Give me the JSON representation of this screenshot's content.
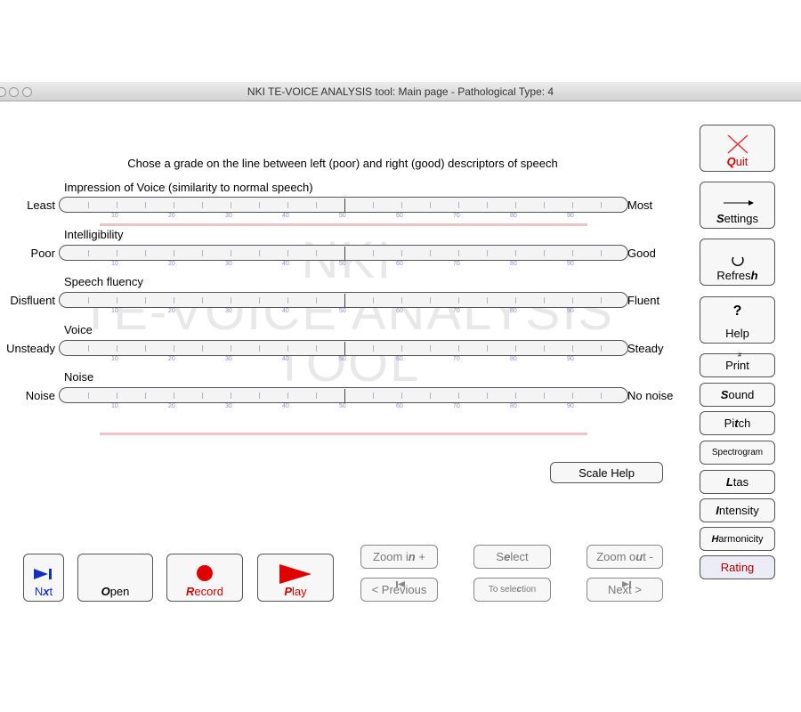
{
  "window": {
    "title": "NKI TE-VOICE ANALYSIS tool: Main page - Pathological Type: 4"
  },
  "watermark": {
    "lines": [
      "NKI",
      "TE-VOICE ANALYSIS",
      "TOOL"
    ]
  },
  "instruction": "Chose a grade on the line between left (poor) and right (good) descriptors of speech",
  "tick_labels": [
    "10",
    "20",
    "30",
    "40",
    "50",
    "60",
    "70",
    "80",
    "90"
  ],
  "scales": [
    {
      "title": "Impression of Voice (similarity to normal speech)",
      "left": "Least",
      "right": "Most"
    },
    {
      "title": "Intelligibility",
      "left": "Poor",
      "right": "Good"
    },
    {
      "title": "Speech fluency",
      "left": "Disfluent",
      "right": "Fluent"
    },
    {
      "title": "Voice",
      "left": "Unsteady",
      "right": "Steady"
    },
    {
      "title": "Noise",
      "left": "Noise",
      "right": "No noise"
    }
  ],
  "sidebar": {
    "quit": {
      "pre": "",
      "hot": "Q",
      "post": "uit"
    },
    "settings": {
      "pre": "",
      "hot": "S",
      "post": "ettings"
    },
    "refresh": {
      "pre": "Refres",
      "hot": "h",
      "post": ""
    },
    "help": {
      "symbol": "?",
      "label": "Help"
    },
    "print": {
      "label": "Print",
      "mark": "#"
    },
    "sound": {
      "pre": "",
      "hot": "S",
      "post": "ound"
    },
    "pitch": {
      "pre": "Pi",
      "hot": "t",
      "post": "ch"
    },
    "spectrogram": "Spectrogram",
    "ltas": {
      "pre": "",
      "hot": "L",
      "post": "tas"
    },
    "intensity": {
      "pre": "",
      "hot": "I",
      "post": "ntensity"
    },
    "harmonicity": {
      "pre": "",
      "hot": "H",
      "post": "armonicity"
    },
    "rating": "Rating"
  },
  "scale_help": "Scale Help",
  "bottom": {
    "next": {
      "pre": "N",
      "hot": "x",
      "post": "t"
    },
    "open": {
      "pre": "",
      "hot": "O",
      "post": "pen"
    },
    "record": {
      "pre": "",
      "hot": "R",
      "post": "ecord"
    },
    "play": {
      "pre": "",
      "hot": "P",
      "post": "lay"
    },
    "zoom_in": {
      "pre": "Zoom i",
      "hot": "n",
      "post": " +"
    },
    "previous": "< Previous",
    "select": {
      "pre": "S",
      "hot": "e",
      "post": "lect"
    },
    "to_selection": {
      "pre": "To sele",
      "hot": "c",
      "post": "tion"
    },
    "zoom_out": {
      "pre": "Zoom o",
      "hot": "u",
      "post": "t -"
    },
    "next_page": "Next >"
  },
  "colors": {
    "accent_red": "#d00000",
    "accent_blue": "#1030c0"
  }
}
